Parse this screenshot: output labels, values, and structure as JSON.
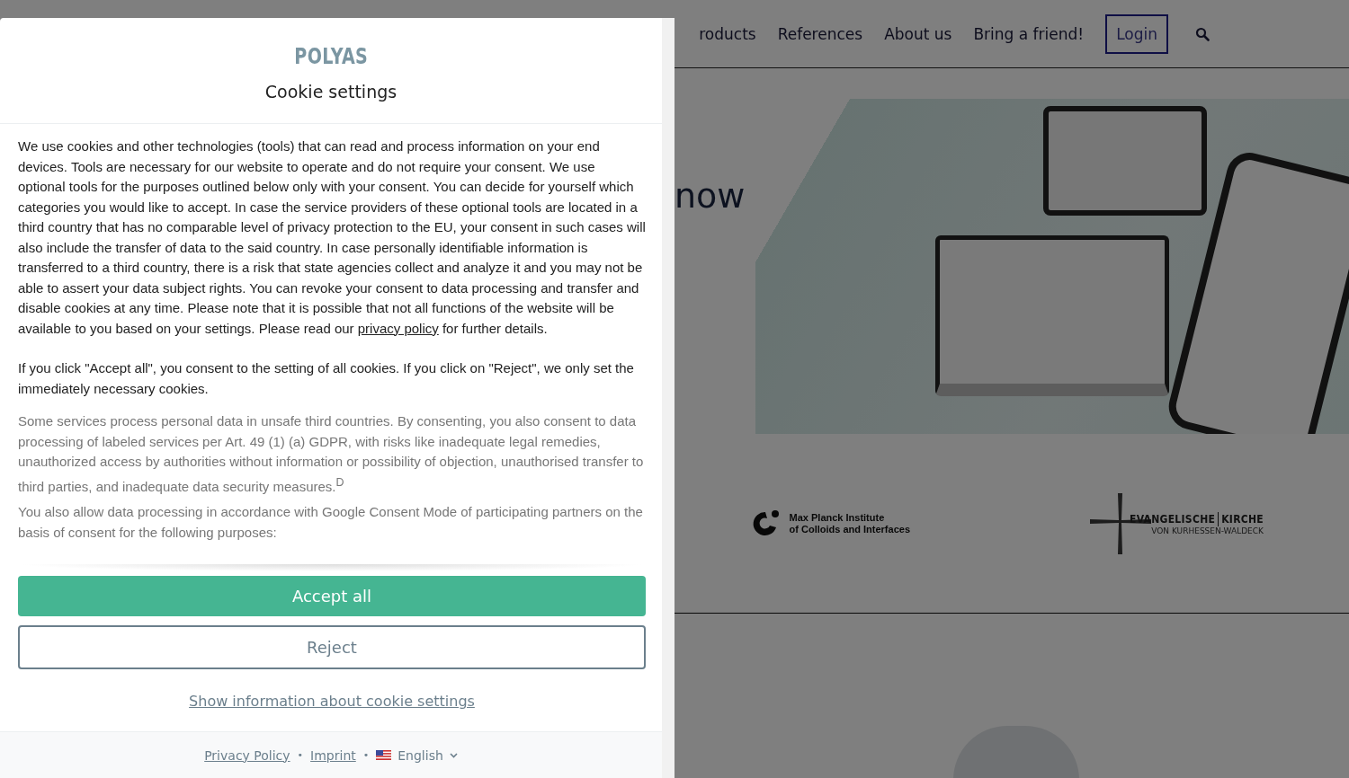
{
  "page": {
    "nav": [
      {
        "label": "roducts",
        "kind": "link"
      },
      {
        "label": "References",
        "kind": "link"
      },
      {
        "label": "About us",
        "kind": "link"
      },
      {
        "label": "Bring a friend!",
        "kind": "link"
      },
      {
        "label": "Login",
        "kind": "button"
      }
    ],
    "hero": {
      "headline": "now"
    },
    "logos": [
      {
        "kind": "mpi",
        "lines": [
          "Max Planck Institute",
          "of Colloids and Interfaces"
        ]
      },
      {
        "kind": "church",
        "lines": [
          "EVANGELISCHE",
          "KIRCHE",
          "VON KURHESSEN-WALDECK"
        ]
      }
    ]
  },
  "dialog": {
    "logo": "POLYAS",
    "title": "Cookie settings",
    "intro": {
      "before": "We use cookies and other technologies (tools) that can read and process information on your end devices. Tools are necessary for our website to operate and do not require your consent. We use optional tools for the purposes outlined below only with your consent. You can decide for yourself which categories you would like to accept. In case the service providers of these optional tools are located in a third country that has no comparable level of privacy protection to the EU, your consent in such cases will also include the transfer of data to the said country. In case personally identifiable information is transferred to a third country, there is a risk that state agencies collect and analyze it and you may not be able to assert your data subject rights. You can revoke your consent to data processing and transfer and disable cookies at any time. Please note that it is possible that not all functions of the website will be available to you based on your settings. Please read our ",
      "link": "privacy policy",
      "after": " for further details."
    },
    "paragraphs": [
      {
        "kind": "main",
        "text": "If you click \"Accept all\", you consent to the setting of all cookies. If you click on \"Reject\", we only set the immediately necessary cookies."
      },
      {
        "kind": "muted",
        "text": "Some services process personal data in unsafe third countries. By consenting, you also consent to data processing of labeled services per Art. 49 (1) (a) GDPR, with risks like inadequate legal remedies, unauthorized access by authorities without information or possibility of objection, unauthorised transfer to third parties, and inadequate data security measures.$^{D}$"
      },
      {
        "kind": "muted",
        "text": "You also allow data processing in accordance with Google Consent Mode of participating partners on the basis of consent for the following purposes:"
      }
    ],
    "buttons": [
      {
        "label": "Accept all",
        "kind": "primary"
      },
      {
        "label": "Reject",
        "kind": "outline"
      }
    ],
    "info_link": "Show information about cookie settings",
    "footer": {
      "links": [
        "Privacy Policy",
        "Imprint"
      ],
      "separator": "•",
      "language": "English"
    }
  }
}
